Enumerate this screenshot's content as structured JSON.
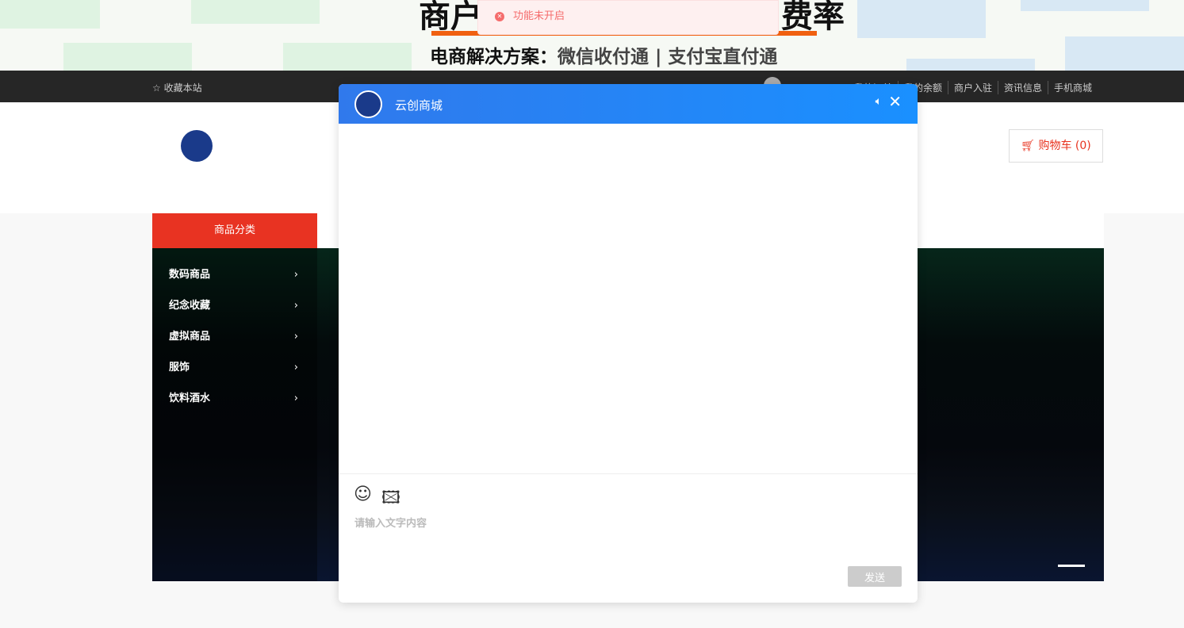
{
  "banner": {
    "title_left": "商户",
    "title_right": "费率",
    "subtitle_strong": "电商解决方案：",
    "subtitle_rest": "微信收付通 | 支付宝直付通"
  },
  "topbar": {
    "favorite": "收藏本站",
    "links": [
      "我的订单",
      "我的余额",
      "商户入驻",
      "资讯信息",
      "手机商城"
    ]
  },
  "header": {
    "cart": "购物车 (0)"
  },
  "nav": {
    "category_header": "商品分类"
  },
  "categories": [
    "数码商品",
    "纪念收藏",
    "虚拟商品",
    "服饰",
    "饮料酒水"
  ],
  "toast": {
    "message": "功能未开启"
  },
  "chat": {
    "title": "云创商城",
    "placeholder": "请输入文字内容",
    "send": "发送"
  }
}
